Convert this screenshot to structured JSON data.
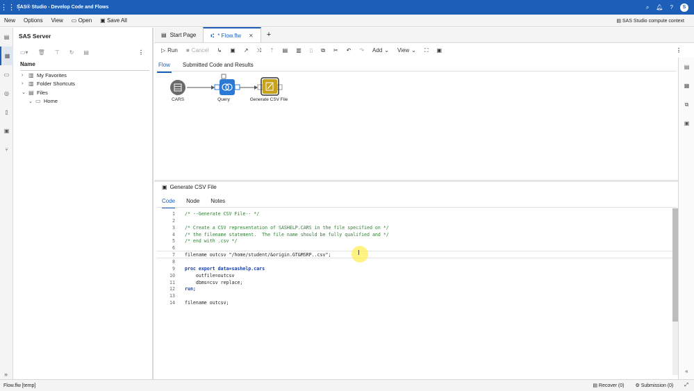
{
  "app": {
    "title": "SAS® Studio - Develop Code and Flows",
    "avatar": "S",
    "compute_context": "SAS Studio compute context"
  },
  "menu": {
    "new": "New",
    "options": "Options",
    "view": "View",
    "open": "Open",
    "save_all": "Save All"
  },
  "left_panel": {
    "title": "SAS Server",
    "column_header": "Name",
    "tree": [
      {
        "label": "My Favorites"
      },
      {
        "label": "Folder Shortcuts"
      },
      {
        "label": "Files"
      },
      {
        "label": "Home"
      }
    ]
  },
  "tabs": {
    "start_page": "Start Page",
    "flow": "* Flow.flw",
    "add": "+"
  },
  "toolbar": {
    "run": "Run",
    "cancel": "Cancel",
    "add": "Add",
    "view": "View"
  },
  "flow_subtabs": {
    "flow": "Flow",
    "submitted": "Submitted Code and Results"
  },
  "flow_nodes": {
    "cars": "CARS",
    "query": "Query",
    "generate": "Generate CSV File"
  },
  "node_panel": {
    "title": "Generate CSV File",
    "tabs": {
      "code": "Code",
      "node": "Node",
      "notes": "Notes"
    }
  },
  "code_lines": [
    {
      "n": "1",
      "text": "/* --Generate CSV File-- */",
      "type": "comment"
    },
    {
      "n": "2",
      "text": "",
      "type": "plain"
    },
    {
      "n": "3",
      "text": "/* Create a CSV representation of SASHELP.CARS in the file specified on */",
      "type": "comment"
    },
    {
      "n": "4",
      "text": "/* the filename statement.  The file name should be fully qualified and */",
      "type": "comment"
    },
    {
      "n": "5",
      "text": "/* end with .csv */",
      "type": "comment"
    },
    {
      "n": "6",
      "text": "",
      "type": "plain"
    },
    {
      "n": "7",
      "text": "filename outcsv \"/home/student/&origin.GT&MSRP..csv\";",
      "type": "plain"
    },
    {
      "n": "8",
      "text": "",
      "type": "plain"
    },
    {
      "n": "9",
      "text": "proc export data=sashelp.cars",
      "type": "kw"
    },
    {
      "n": "10",
      "text": "    outfile=outcsv",
      "type": "plain"
    },
    {
      "n": "11",
      "text": "    dbms=csv replace;",
      "type": "plain"
    },
    {
      "n": "12",
      "text": "run;",
      "type": "kw"
    },
    {
      "n": "13",
      "text": "",
      "type": "plain"
    },
    {
      "n": "14",
      "text": "filename outcsv;",
      "type": "plain"
    }
  ],
  "status": {
    "left": "Flow.flw [temp]",
    "recover": "Recover (0)",
    "submission": "Submission (0)"
  },
  "colors": {
    "brand_blue": "#1d5fb8",
    "query_node": "#2a7ad5",
    "generate_node": "#c7a21a"
  }
}
